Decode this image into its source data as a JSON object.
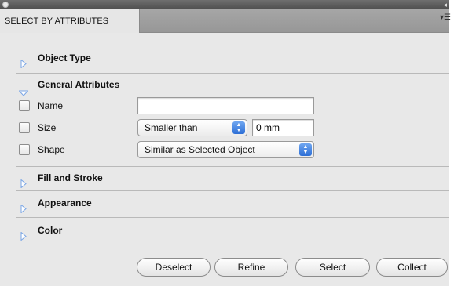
{
  "panel": {
    "tab_label": "SELECT BY ATTRIBUTES",
    "menu_icon": "▾☰",
    "collapse_icon": "◂"
  },
  "sections": {
    "object_type": "Object Type",
    "general_attributes": "General Attributes",
    "fill_and_stroke": "Fill and Stroke",
    "appearance": "Appearance",
    "color": "Color"
  },
  "general": {
    "name_label": "Name",
    "name_value": "",
    "size_label": "Size",
    "size_mode": "Smaller than",
    "size_value": "0 mm",
    "shape_label": "Shape",
    "shape_mode": "Similar as Selected Object"
  },
  "buttons": {
    "deselect": "Deselect",
    "refine": "Refine",
    "select": "Select",
    "collect": "Collect"
  },
  "colors": {
    "accent": "#3a7be0",
    "panel_bg": "#e8e8e8",
    "titlebar": "#5a5a5a"
  }
}
